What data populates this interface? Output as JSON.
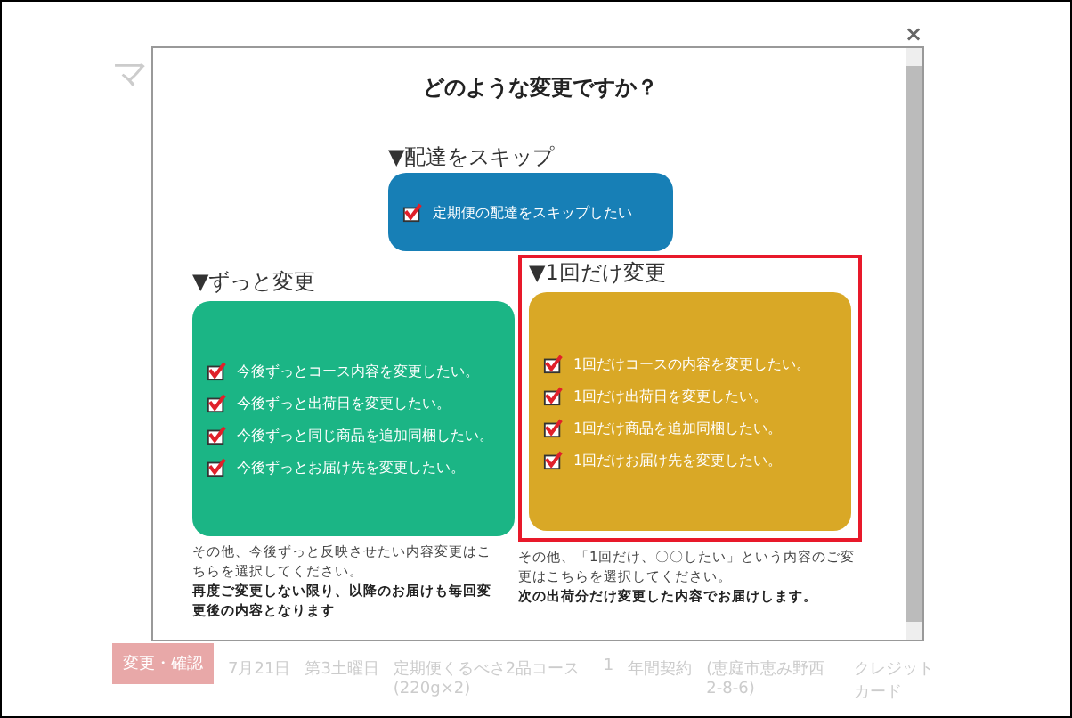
{
  "background": {
    "heading": "マ",
    "row": {
      "button": "変更・確認",
      "cells": [
        "7月21日",
        "第3土曜日",
        "定期便くるべさ2品コース(220g×2)",
        "1",
        "年間契約",
        "(恵庭市恵み野西2-8-6)",
        "クレジットカード"
      ]
    }
  },
  "dialog": {
    "close": "×",
    "title": "どのような変更ですか？",
    "skip": {
      "heading": "▼配達をスキップ",
      "options": [
        {
          "label": "定期便の配達をスキップしたい",
          "checked": true
        }
      ]
    },
    "sections": [
      {
        "heading": "▼ずっと変更",
        "kind": "permanent",
        "highlighted": false,
        "options": [
          {
            "label": "今後ずっとコース内容を変更したい。",
            "checked": true
          },
          {
            "label": "今後ずっと出荷日を変更したい。",
            "checked": true
          },
          {
            "label": "今後ずっと同じ商品を追加同梱したい。",
            "checked": true
          },
          {
            "label": "今後ずっとお届け先を変更したい。",
            "checked": true
          }
        ],
        "note": "その他、今後ずっと反映させたい内容変更はこちらを選択してください。",
        "note_bold": "再度ご変更しない限り、以降のお届けも毎回変更後の内容となります"
      },
      {
        "heading": "▼1回だけ変更",
        "kind": "once",
        "highlighted": true,
        "options": [
          {
            "label": "1回だけコースの内容を変更したい。",
            "checked": true
          },
          {
            "label": "1回だけ出荷日を変更したい。",
            "checked": true
          },
          {
            "label": "1回だけ商品を追加同梱したい。",
            "checked": true
          },
          {
            "label": "1回だけお届け先を変更したい。",
            "checked": true
          }
        ],
        "note": "その他、「1回だけ、〇〇したい」という内容のご変更はこちらを選択してください。",
        "note_bold": "次の出荷分だけ変更した内容でお届けします。"
      }
    ]
  }
}
